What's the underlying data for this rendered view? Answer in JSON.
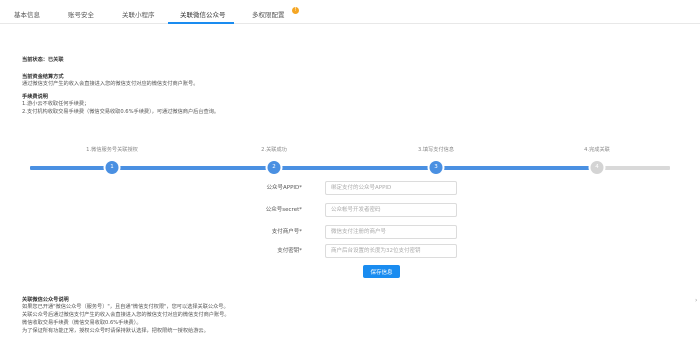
{
  "tabs": [
    {
      "label": "基本信息"
    },
    {
      "label": "账号安全"
    },
    {
      "label": "关联小程序"
    },
    {
      "label": "关联微信公众号"
    },
    {
      "label": "多权限配置"
    }
  ],
  "badge": "!",
  "status": {
    "text": "当前状态：已关联"
  },
  "payment_method": {
    "title": "当前资金结算方式",
    "desc": "通过微信支付产生的收入会直接进入您的微信支付对应的微信支付商户账号。"
  },
  "fee": {
    "title": "手续费说明",
    "lines": [
      "1.游小云不收取任何手续费；",
      "2.支付机构收取交易手续费（微信交易收取0.6%手续费），可通过微信商户后台查询。"
    ]
  },
  "steps": [
    {
      "label": "1.微信服务号关联授权",
      "num": "1"
    },
    {
      "label": "2.关联成功",
      "num": "2"
    },
    {
      "label": "3.填写支付信息",
      "num": "3"
    },
    {
      "label": "4.完成关联",
      "num": "4"
    }
  ],
  "form": {
    "appid_label": "公众号APPID*",
    "appid_placeholder": "绑定支付的公众号APPID",
    "secret_label": "公众号secret*",
    "secret_placeholder": "公众帐号开发者密码",
    "mch_label": "支付商户号*",
    "mch_placeholder": "微信支付注册的商户号",
    "key_label": "支付密钥*",
    "key_placeholder": "商户后台设置的长度为32位支付密钥",
    "save_label": "保存信息"
  },
  "note": {
    "title": "关联微信公众号说明",
    "lines": [
      "如果您已开通\"微信公众号（服务号）\"，且自通\"微信支付权限\"，您可以选择关联公众号。",
      "关联公众号后通过微信支付产生的收入会直接进入您的微信支付对应的微信支付商户账号。",
      "微信收取交易手续费（微信交易收取0.6%手续费）。",
      "为了保证所有功能正常，授权公众号时请保持默认选择，把权限统一授权给游云。"
    ]
  }
}
